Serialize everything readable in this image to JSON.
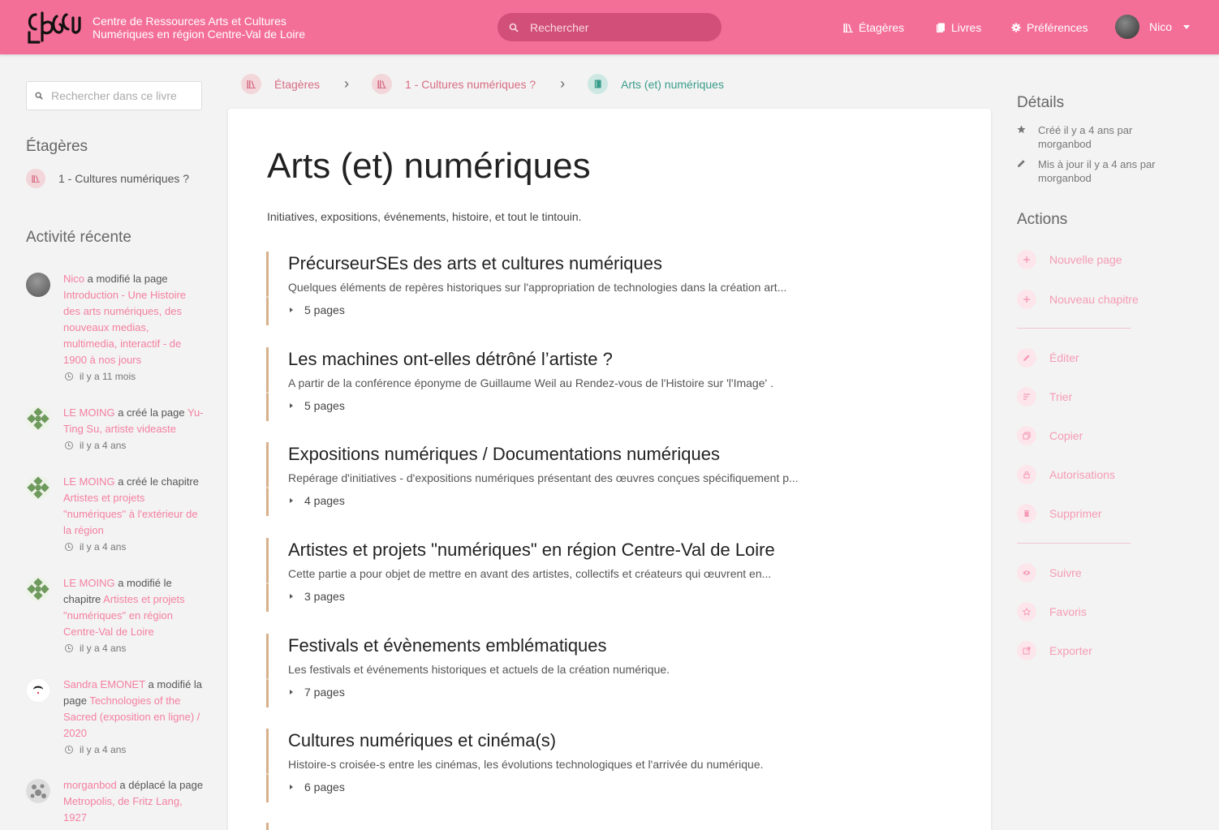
{
  "header": {
    "site_name_line1": "Centre de Ressources Arts et Cultures",
    "site_name_line2": "Numériques en région Centre-Val de Loire",
    "search_placeholder": "Rechercher",
    "nav": {
      "shelves": "Étagères",
      "books": "Livres",
      "settings": "Préférences"
    },
    "user_name": "Nico",
    "brand_color": "#f46f97"
  },
  "left": {
    "book_search_placeholder": "Rechercher dans ce livre",
    "shelves_title": "Étagères",
    "shelf_item": "1 - Cultures numériques ?",
    "activity_title": "Activité récente",
    "activities": [
      {
        "user": "Nico",
        "action": "a modifié la page",
        "target": "Introduction - Une Histoire des arts numériques, des nouveaux medias, multimedia, interactif - de 1900 à nos jours",
        "time": "il y a 11 mois"
      },
      {
        "user": "LE MOING",
        "action": "a créé la page",
        "target": "Yu-Ting Su, artiste videaste",
        "time": "il y a 4 ans"
      },
      {
        "user": "LE MOING",
        "action": "a créé le chapitre",
        "target": "Artistes et projets \"numériques\" à l'extérieur de la région",
        "time": "il y a 4 ans"
      },
      {
        "user": "LE MOING",
        "action": "a modifié le chapitre",
        "target": "Artistes et projets \"numériques\" en région Centre-Val de Loire",
        "time": "il y a 4 ans"
      },
      {
        "user": "Sandra EMONET",
        "action": "a modifié la page",
        "target": "Technologies of the Sacred (exposition en ligne) / 2020",
        "time": "il y a 4 ans"
      },
      {
        "user": "morganbod",
        "action": "a déplacé la page",
        "target": "Metropolis, de Fritz Lang, 1927",
        "time": ""
      }
    ]
  },
  "breadcrumb": {
    "shelves": "Étagères",
    "shelf": "1 - Cultures numériques ?",
    "book": "Arts (et) numériques"
  },
  "book": {
    "title": "Arts (et) numériques",
    "description": "Initiatives, expositions, événements, histoire, et tout le tintouin.",
    "chapters": [
      {
        "title": "PrécurseurSEs des arts et cultures numériques",
        "desc": "Quelques éléments de repères historiques sur l'appropriation de technologies dans la création art...",
        "pages": "5 pages"
      },
      {
        "title": "Les machines ont-elles détrôné l’artiste ?",
        "desc": "A partir de la conférence éponyme de Guillaume Weil au Rendez-vous de l'Histoire sur 'l'Image' .",
        "pages": "5 pages"
      },
      {
        "title": "Expositions numériques / Documentations numériques",
        "desc": "Repérage d'initiatives - d'expositions numériques présentant des œuvres conçues spécifiquement p...",
        "pages": "4 pages"
      },
      {
        "title": "Artistes et projets \"numériques\" en région Centre-Val de Loire",
        "desc": "Cette partie a pour objet de mettre en avant des artistes, collectifs et créateurs qui œuvrent en...",
        "pages": "3 pages"
      },
      {
        "title": "Festivals et évènements emblématiques",
        "desc": "Les festivals et événements historiques et actuels de la création numérique.",
        "pages": "7 pages"
      },
      {
        "title": "Cultures numériques et cinéma(s)",
        "desc": "Histoire-s croisée-s entre les cinémas, les évolutions technologiques et l'arrivée du numérique.",
        "pages": "6 pages"
      }
    ]
  },
  "right": {
    "details_title": "Détails",
    "created": "Créé il y a 4 ans par morganbod",
    "updated": "Mis à jour il y a 4 ans par morganbod",
    "actions_title": "Actions",
    "actions": {
      "new_page": "Nouvelle page",
      "new_chapter": "Nouveau chapitre",
      "edit": "Éditer",
      "sort": "Trier",
      "copy": "Copier",
      "permissions": "Autorisations",
      "delete": "Supprimer",
      "watch": "Suivre",
      "favorite": "Favoris",
      "export": "Exporter"
    }
  }
}
